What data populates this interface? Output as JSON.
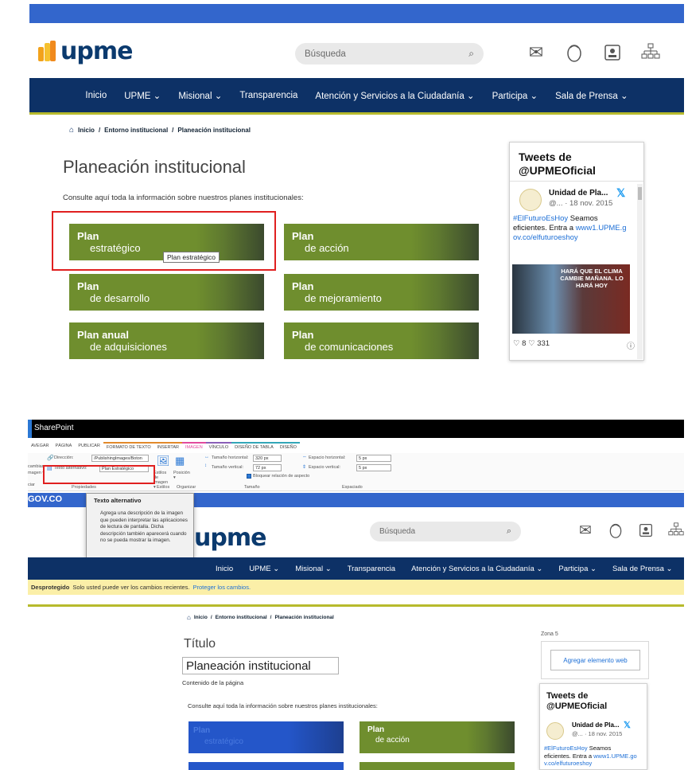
{
  "site": {
    "logo_text": "upme",
    "search_placeholder": "Búsqueda",
    "nav": [
      "Inicio",
      "UPME ⌄",
      "Misional ⌄",
      "Transparencia",
      "Atención y Servicios a la Ciudadanía ⌄",
      "Participa ⌄",
      "Sala de Prensa ⌄"
    ],
    "breadcrumb": [
      "Inicio",
      "/",
      "Entorno institucional",
      "/",
      "Planeación institucional"
    ],
    "title": "Planeación institucional",
    "intro": "Consulte aquí toda la información sobre nuestros planes institucionales:",
    "cards": [
      {
        "t1": "Plan",
        "t2": "estratégico"
      },
      {
        "t1": "Plan",
        "t2": "de acción"
      },
      {
        "t1": "Plan",
        "t2": "de desarrollo"
      },
      {
        "t1": "Plan",
        "t2": "de mejoramiento"
      },
      {
        "t1": "Plan anual",
        "t2": "de adquisiciones"
      },
      {
        "t1": "Plan",
        "t2": "de comunicaciones"
      }
    ],
    "tooltip": "Plan estratégico",
    "icons": [
      "mail-icon",
      "user-icon",
      "contact-card-icon",
      "sitemap-icon"
    ],
    "colors": {
      "gov_blue": "#3366cc",
      "nav_navy": "#0d3166",
      "accent_olive": "#b7ba2c",
      "card_green": "#6f8e2e",
      "highlight_red": "#e02020"
    }
  },
  "twitter": {
    "header": "Tweets de @UPMEOficial",
    "author": "Unidad de Pla...",
    "handle": "@... · 18 nov. 2015",
    "text_hashtag": "#ElFuturoEsHoy",
    "text_body": " Seamos eficientes. Entra a ",
    "text_link": "www1.UPME.gov.co/elfuturoeshoy",
    "image_caption": "HARÁ QUE EL CLIMA CAMBIE MAÑANA. LO HARÁ HOY",
    "stats": "♡ 8  ♡ 331",
    "info": "ⓘ"
  },
  "sharepoint": {
    "app_title": "SharePoint",
    "ribbon_tabs": [
      "AVEGAR",
      "PÁGINA",
      "PUBLICAR",
      "FORMATO DE TEXTO",
      "INSERTAR",
      "IMAGEN",
      "VÍNCULO",
      "DISEÑO DE TABLA",
      "DISEÑO"
    ],
    "direccion_label": "Dirección:",
    "direccion_value": "/PublishingImages/Boton",
    "alt_label": "Texto alternativo:",
    "alt_value": "Plan Estratégico",
    "group_props": "Propiedades",
    "group_styles": "Estilos",
    "group_org": "Organizar",
    "group_size": "Tamaño",
    "group_spacing": "Espaciado",
    "estilos_btn": "Estilos de imagen ▾",
    "posicion_btn": "Posición ▾",
    "h_size_label": "Tamaño horizontal:",
    "h_size_value": "320 px",
    "v_size_label": "Tamaño vertical:",
    "v_size_value": "72 px",
    "lock_label": "Bloquear relación de aspecto",
    "h_space_label": "Espacio horizontal:",
    "h_space_value": "5 px",
    "v_space_label": "Espacio vertical:",
    "v_space_value": "5 px",
    "gov": "GOV.CO",
    "alt_popup_title": "Texto alternativo",
    "alt_popup_desc": "Agrega una descripción de la imagen que pueden interpretar las aplicaciones de lectura de pantalla. Dicha descripción también aparecerá cuando no se pueda mostrar la imagen.",
    "unprotected_bold": "Desprotegido",
    "unprotected_text": "Solo usted puede ver los cambios recientes.",
    "unprotected_link": "Proteger los cambios.",
    "title_label": "Título",
    "title_value": "Planeación institucional",
    "content_label": "Contenido de la página",
    "zona": "Zona 5",
    "add_webpart": "Agregar elemento web",
    "side_left_labels": [
      "cambiar",
      "Dirección",
      "magen ▾"
    ],
    "side_left_cut": "ciar"
  }
}
